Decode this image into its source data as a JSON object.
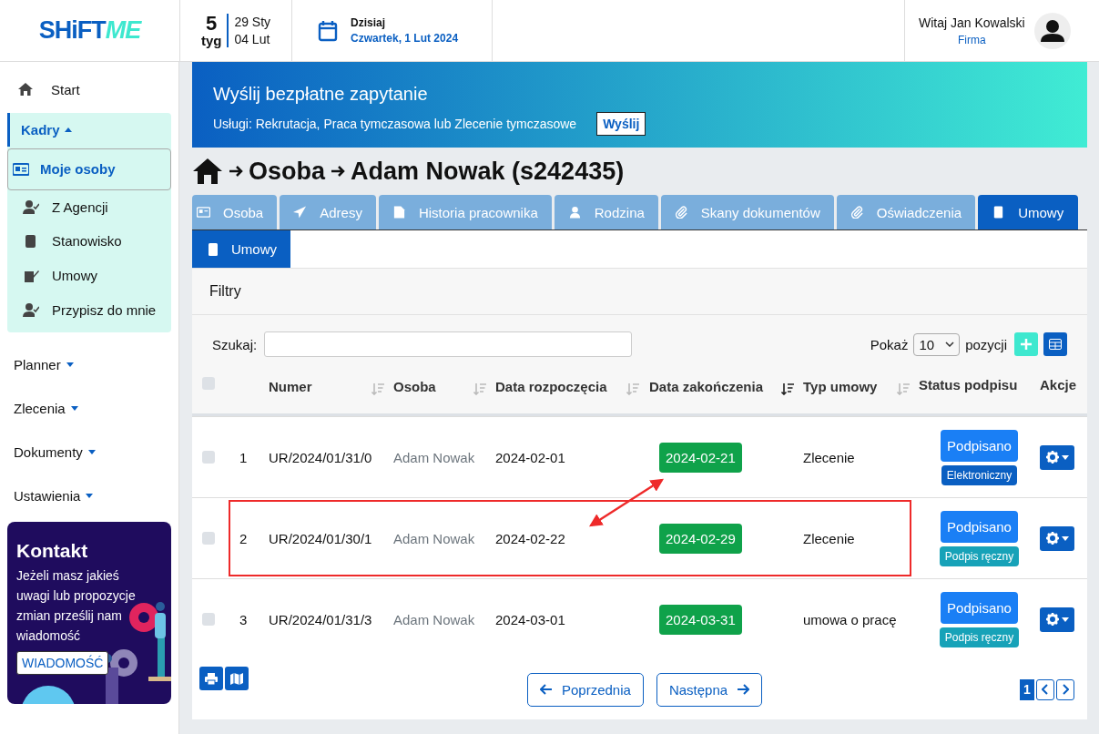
{
  "header": {
    "logo": [
      "SHiFT",
      "ME"
    ],
    "week": {
      "number": "5",
      "label": "tyg",
      "from": "29 Sty",
      "to": "04 Lut"
    },
    "today": {
      "label": "Dzisiaj",
      "date": "Czwartek, 1 Lut 2024"
    },
    "user": {
      "greeting": "Witaj Jan Kowalski",
      "company": "Firma"
    }
  },
  "sidebar": {
    "items": [
      {
        "label": "Start",
        "kind": "link"
      },
      {
        "label": "Kadry",
        "kind": "group",
        "expanded": true,
        "children": [
          {
            "label": "Moje osoby",
            "selected": true
          },
          {
            "label": "Z Agencji",
            "selected": false
          },
          {
            "label": "Stanowisko",
            "selected": false
          },
          {
            "label": "Umowy",
            "selected": false
          },
          {
            "label": "Przypisz do mnie",
            "selected": false
          }
        ]
      },
      {
        "label": "Planner",
        "kind": "menu",
        "expanded": false
      },
      {
        "label": "Zlecenia",
        "kind": "menu",
        "expanded": false
      },
      {
        "label": "Dokumenty",
        "kind": "menu",
        "expanded": false
      },
      {
        "label": "Ustawienia",
        "kind": "menu",
        "expanded": false
      }
    ],
    "contact": {
      "title": "Kontakt",
      "text": "Jeżeli masz jakieś uwagi lub propozycje zmian prześlij nam wiadomość",
      "button": "WIADOMOŚĆ"
    }
  },
  "banner": {
    "title": "Wyślij bezpłatne zapytanie",
    "text": "Usługi: Rekrutacja, Praca tymczasowa lub Zlecenie tymczasowe",
    "button": "Wyślij"
  },
  "breadcrumb": [
    "Osoba",
    "Adam Nowak (s242435)"
  ],
  "tabs": [
    {
      "label": "Osoba",
      "selected": false
    },
    {
      "label": "Adresy",
      "selected": false
    },
    {
      "label": "Historia pracownika",
      "selected": false
    },
    {
      "label": "Rodzina",
      "selected": false
    },
    {
      "label": "Skany dokumentów",
      "selected": false
    },
    {
      "label": "Oświadczenia",
      "selected": false
    },
    {
      "label": "Umowy",
      "selected": true
    }
  ],
  "subtabs": [
    {
      "label": "Umowy",
      "selected": true
    }
  ],
  "filters": {
    "title": "Filtry",
    "search_label": "Szukaj:",
    "show_label": "Pokaż",
    "page_size": "10",
    "per_label": "pozycji"
  },
  "table": {
    "select_all_checked": false,
    "columns": [
      {
        "label": "Numer",
        "sorted": false
      },
      {
        "label": "Osoba",
        "sorted": false
      },
      {
        "label": "Data rozpoczęcia",
        "sorted": false
      },
      {
        "label": "Data zakończenia",
        "sorted": true
      },
      {
        "label": "Typ umowy",
        "sorted": false
      },
      {
        "label": "Status podpisu"
      },
      {
        "label": "Akcje"
      }
    ],
    "rows": [
      {
        "index": "1",
        "number": "UR/2024/01/31/0",
        "person": "Adam Nowak",
        "start": "2024-02-01",
        "end": "2024-02-21",
        "type": "Zlecenie",
        "status": "Podpisano",
        "signature": {
          "label": "Elektroniczny",
          "kind": "electronic"
        },
        "checked": false,
        "highlighted": false
      },
      {
        "index": "2",
        "number": "UR/2024/01/30/1",
        "person": "Adam Nowak",
        "start": "2024-02-22",
        "end": "2024-02-29",
        "type": "Zlecenie",
        "status": "Podpisano",
        "signature": {
          "label": "Podpis ręczny",
          "kind": "manual"
        },
        "checked": false,
        "highlighted": true
      },
      {
        "index": "3",
        "number": "UR/2024/01/31/3",
        "person": "Adam Nowak",
        "start": "2024-03-01",
        "end": "2024-03-31",
        "type": "umowa o pracę",
        "status": "Podpisano",
        "signature": {
          "label": "Podpis ręczny",
          "kind": "manual"
        },
        "checked": false,
        "highlighted": false
      }
    ]
  },
  "pager": {
    "previous": "Poprzednia",
    "next": "Następna",
    "pages": [
      {
        "label": "1",
        "selected": true
      }
    ]
  }
}
